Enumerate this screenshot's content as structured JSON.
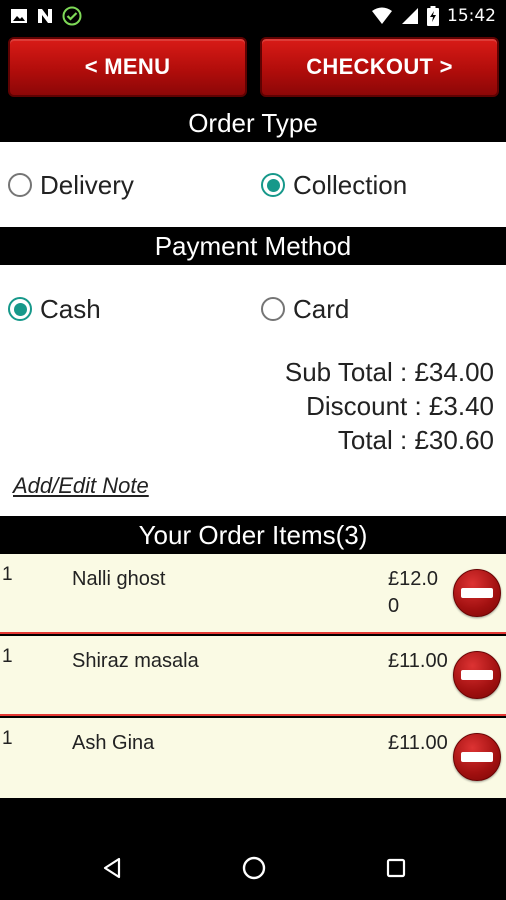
{
  "status_bar": {
    "time": "15:42",
    "left_icons": [
      "image-icon",
      "n-icon",
      "check-circle-icon"
    ],
    "right_icons": [
      "wifi-icon",
      "signal-icon",
      "battery-icon"
    ]
  },
  "toolbar": {
    "menu_label": "< MENU",
    "checkout_label": "CHECKOUT >"
  },
  "order_type": {
    "header": "Order Type",
    "options": [
      {
        "label": "Delivery",
        "selected": false
      },
      {
        "label": "Collection",
        "selected": true
      }
    ]
  },
  "payment_method": {
    "header": "Payment Method",
    "options": [
      {
        "label": "Cash",
        "selected": true
      },
      {
        "label": "Card",
        "selected": false
      }
    ]
  },
  "totals": {
    "sub_total": "Sub Total : £34.00",
    "discount": "Discount : £3.40",
    "total": "Total : £30.60"
  },
  "note_link": "Add/Edit Note",
  "order_items": {
    "header": "Your Order Items(3)",
    "items": [
      {
        "qty": "1",
        "name": "Nalli ghost",
        "price": "£12.00"
      },
      {
        "qty": "1",
        "name": "Shiraz masala",
        "price": "£11.00"
      },
      {
        "qty": "1",
        "name": "Ash Gina",
        "price": "£11.00"
      }
    ]
  },
  "colors": {
    "accent": "#16988a",
    "button_red": "#c0120f",
    "item_bg": "#fafae4",
    "divider": "#e53935"
  }
}
